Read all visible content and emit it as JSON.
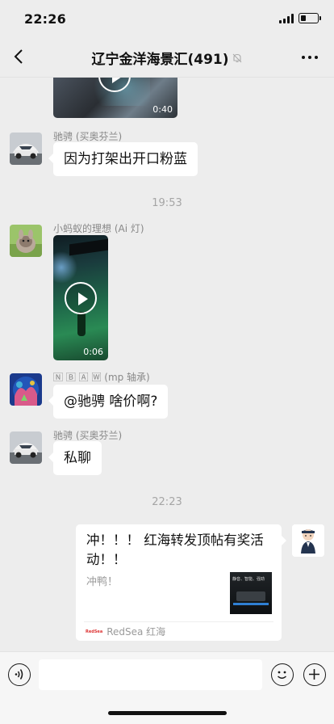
{
  "status_bar": {
    "time": "22:26",
    "battery_level": 0.3
  },
  "header": {
    "title": "辽宁金洋海景汇(491)",
    "muted": true
  },
  "messages": [
    {
      "type": "video",
      "sender": "",
      "duration": "0:40"
    },
    {
      "type": "text",
      "sender": "驰骋 (买奥芬兰)",
      "text": "因为打架出开口粉蓝"
    },
    {
      "type": "timestamp",
      "text": "19:53"
    },
    {
      "type": "video",
      "sender": "小蚂蚁的理想 (Ai 灯)",
      "duration": "0:06"
    },
    {
      "type": "text",
      "sender": "🄽 🄱 🄰 🅆 (mp 轴承)",
      "text": "@驰骋 啥价啊?"
    },
    {
      "type": "text",
      "sender": "驰骋 (买奥芬兰)",
      "text": "私聊"
    },
    {
      "type": "timestamp",
      "text": "22:23"
    },
    {
      "type": "link",
      "sender": "self",
      "title": "冲！！！ 红海转发顶帖有奖活动！！",
      "desc": "冲鸭！",
      "thumb_text": "静音、智能、强劲",
      "source": "RedSea 红海"
    }
  ],
  "input": {
    "placeholder": ""
  }
}
